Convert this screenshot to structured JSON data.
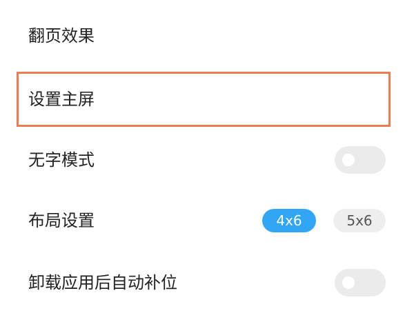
{
  "settings": {
    "page_flip_label": "翻页效果",
    "set_home_label": "设置主屏",
    "no_text_mode": {
      "label": "无字模式",
      "enabled": false
    },
    "layout": {
      "label": "布局设置",
      "options": [
        "4x6",
        "5x6"
      ],
      "selected": "4x6"
    },
    "auto_fill_on_uninstall": {
      "label": "卸载应用后自动补位",
      "enabled": false
    }
  },
  "colors": {
    "highlight_border": "#ee7a4f",
    "selected_option": "#30a6f5",
    "toggle_off": "#ebebeb"
  }
}
